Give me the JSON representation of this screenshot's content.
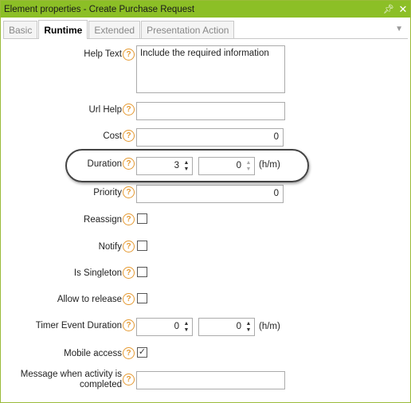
{
  "window": {
    "title": "Element properties - Create Purchase Request",
    "pin_icon": "pin-icon",
    "close_icon": "close-icon"
  },
  "tabs": [
    {
      "label": "Basic",
      "active": false
    },
    {
      "label": "Runtime",
      "active": true
    },
    {
      "label": "Extended",
      "active": false
    },
    {
      "label": "Presentation Action",
      "active": false
    }
  ],
  "fields": {
    "help_text": {
      "label": "Help Text",
      "value": "Include the required information"
    },
    "url_help": {
      "label": "Url Help",
      "value": ""
    },
    "cost": {
      "label": "Cost",
      "value": "0"
    },
    "duration": {
      "label": "Duration",
      "hours": "3",
      "minutes": "0",
      "unit": "(h/m)"
    },
    "priority": {
      "label": "Priority",
      "value": "0"
    },
    "reassign": {
      "label": "Reassign",
      "checked": false
    },
    "notify": {
      "label": "Notify",
      "checked": false
    },
    "is_singleton": {
      "label": "Is Singleton",
      "checked": false
    },
    "allow_to_release": {
      "label": "Allow to release",
      "checked": false
    },
    "timer_event_duration": {
      "label": "Timer Event Duration",
      "hours": "0",
      "minutes": "0",
      "unit": "(h/m)"
    },
    "mobile_access": {
      "label": "Mobile access",
      "checked": true,
      "check_mark": "✓"
    },
    "message_when_completed": {
      "label": "Message when activity is completed",
      "value": ""
    }
  },
  "help_glyph": "?",
  "colors": {
    "titlebar": "#8cbf26",
    "help_icon": "#e59a32",
    "highlight_outline": "#444444"
  }
}
